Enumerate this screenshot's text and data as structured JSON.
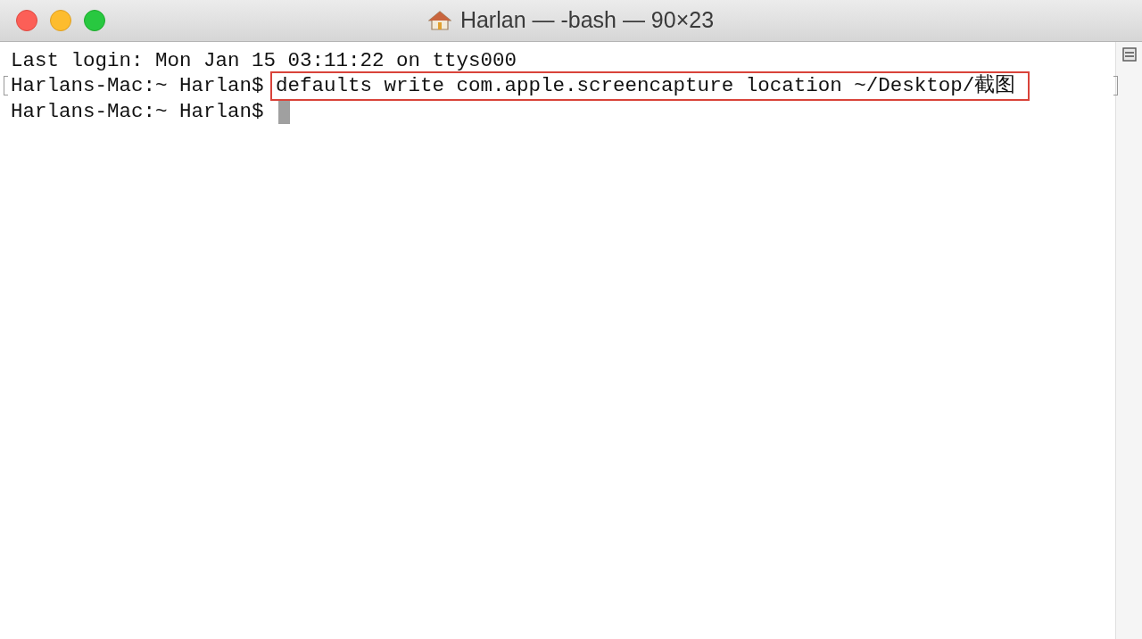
{
  "window": {
    "title": "Harlan — -bash — 90×23"
  },
  "lines": [
    {
      "kind": "output",
      "text": "Last login: Mon Jan 15 03:11:22 on ttys000",
      "marked": false,
      "highlighted": false,
      "cursor": false
    },
    {
      "kind": "command",
      "prompt": "Harlans-Mac:~ Harlan$",
      "text": "defaults write com.apple.screencapture location ~/Desktop/截图",
      "marked": true,
      "highlighted": true,
      "cursor": false
    },
    {
      "kind": "command",
      "prompt": "Harlans-Mac:~ Harlan$",
      "marked": false,
      "highlighted": false,
      "cursor": true
    }
  ]
}
